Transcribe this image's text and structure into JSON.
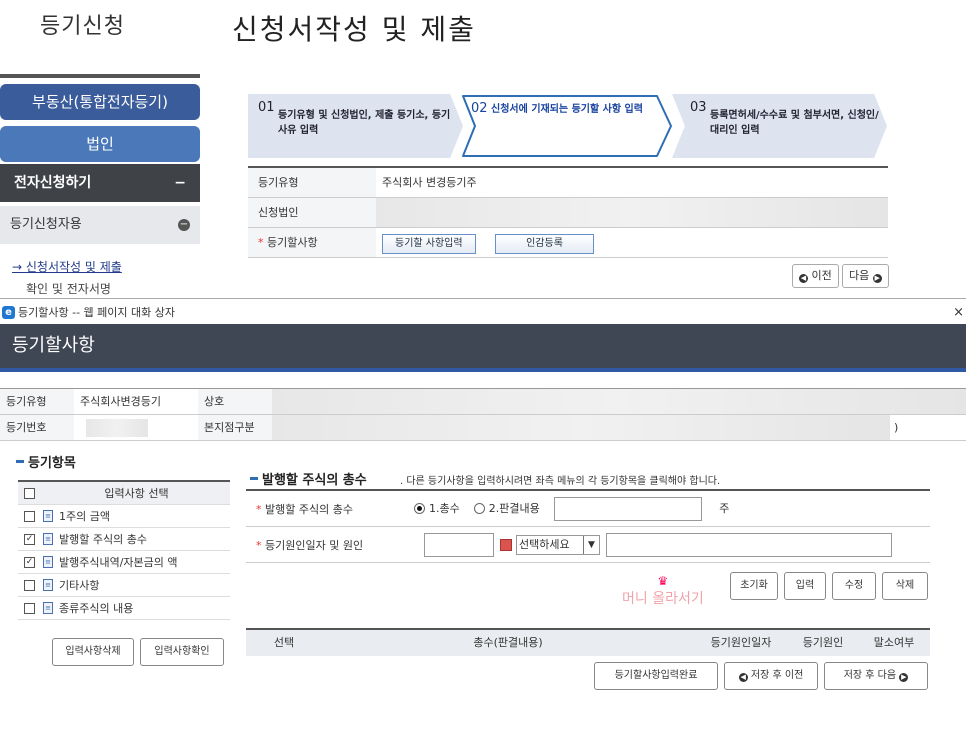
{
  "header": {
    "left_title": "등기신청",
    "main_title": "신청서작성 및 제출"
  },
  "sidebar": {
    "btn1": "부동산(통합전자등기)",
    "btn2": "법인",
    "section": "전자신청하기",
    "section_toggle": "−",
    "sub_section": "등기신청자용",
    "sub_toggle": "−",
    "link1": "→ 신청서작성 및 제출",
    "link2": "확인 및 전자서명"
  },
  "steps": [
    {
      "num": "01",
      "label": "등기유형 및 신청법인, 제출 등기소, 등기사유 입력"
    },
    {
      "num": "02",
      "label": "신청서에 기재되는 등기할 사항 입력"
    },
    {
      "num": "03",
      "label": "등록면허세/수수료 및 첨부서면, 신청인/대리인 입력"
    }
  ],
  "top_table": {
    "row1_label": "등기유형",
    "row1_value": "주식회사 변경등기주",
    "row2_label": "신청법인",
    "row3_label": "등기할사항",
    "btn_input": "등기할 사항입력",
    "btn_seal": "인감등록"
  },
  "nav": {
    "prev": "이전",
    "next": "다음"
  },
  "dialog": {
    "window_title": "등기할사항 -- 웹 페이지 대화 상자",
    "close": "×",
    "ie_icon": "e",
    "heading": "등기할사항",
    "info": {
      "type_label": "등기유형",
      "type_value": "주식회사변경등기",
      "name_label": "상호",
      "regno_label": "등기번호",
      "branch_label": "본지점구분",
      "branch_tail": ")"
    },
    "items_title": "등기항목",
    "items_header": "입력사항 선택",
    "items": [
      {
        "label": "1주의 금액",
        "checked": false
      },
      {
        "label": "발행할 주식의 총수",
        "checked": true
      },
      {
        "label": "발행주식내역/자본금의 액",
        "checked": true
      },
      {
        "label": "기타사항",
        "checked": false
      },
      {
        "label": "종류주식의 내용",
        "checked": false
      }
    ],
    "btn_delete_items": "입력사항삭제",
    "btn_confirm_items": "입력사항확인",
    "form_title": "발행할 주식의 총수",
    "form_note": ". 다른 등기사항을 입력하시려면 좌측 메뉴의 각 등기항목을 클릭해야 합니다.",
    "field1_label": "발행할 주식의 총수",
    "radio1": "1.총수",
    "radio2": "2.판결내용",
    "unit": "주",
    "field2_label": "등기원인일자 및 원인",
    "select_value": "선택하세요",
    "btn_reset": "초기화",
    "btn_add": "입력",
    "btn_edit": "수정",
    "btn_del": "삭제",
    "watermark": "머니 올라서기",
    "grid_headers": [
      "선택",
      "총수(판결내용)",
      "등기원인일자",
      "등기원인",
      "말소여부"
    ],
    "btn_complete": "등기할사항입력완료",
    "btn_save_prev": "저장 후 이전",
    "btn_save_next": "저장 후 다음"
  }
}
